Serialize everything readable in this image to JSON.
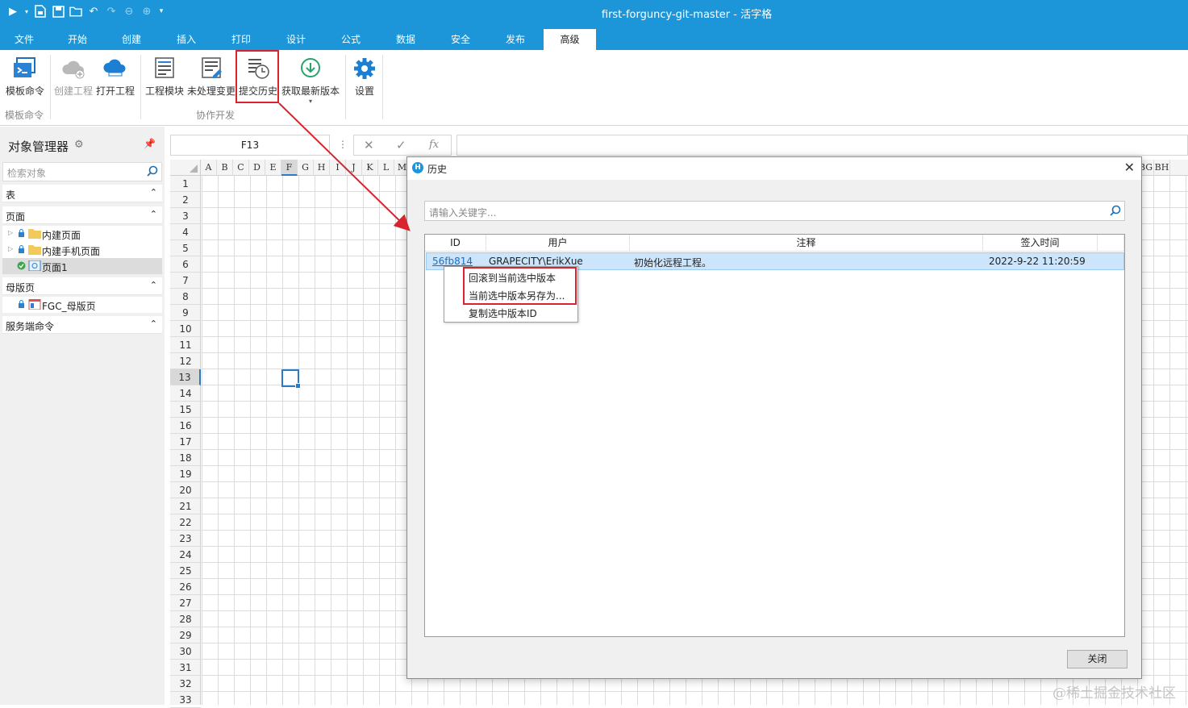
{
  "app": {
    "title": "first-forguncy-git-master - 活字格"
  },
  "tabs": [
    "文件",
    "开始",
    "创建",
    "插入",
    "打印",
    "设计",
    "公式",
    "数据",
    "安全",
    "发布",
    "高级"
  ],
  "ribbon": {
    "buttons": {
      "template_cmd": "模板命令",
      "create_project": "创建工程",
      "open_project": "打开工程",
      "project_module": "工程模块",
      "pending_changes": "未处理变更",
      "commit_history": "提交历史",
      "get_latest": "获取最新版本",
      "settings": "设置"
    },
    "groups": {
      "template": "模板命令",
      "collab": "协作开发"
    }
  },
  "left_panel": {
    "title": "对象管理器",
    "search_placeholder": "检索对象",
    "sections": {
      "tables": "表",
      "pages": "页面",
      "master": "母版页",
      "server": "服务端命令"
    },
    "pages": [
      "内建页面",
      "内建手机页面",
      "页面1"
    ],
    "master_pages": [
      "FGC_母版页"
    ]
  },
  "formula_bar": {
    "cell_ref": "F13",
    "fx": "fx"
  },
  "grid": {
    "columns": [
      "A",
      "B",
      "C",
      "D",
      "E",
      "F",
      "G",
      "H",
      "I",
      "J",
      "K",
      "L",
      "M"
    ],
    "right_cols": [
      "BG",
      "BH"
    ],
    "rows": [
      "1",
      "2",
      "3",
      "4",
      "5",
      "6",
      "7",
      "8",
      "9",
      "10",
      "11",
      "12",
      "13",
      "14",
      "15",
      "16",
      "17",
      "18",
      "19",
      "20",
      "21",
      "22",
      "23",
      "24",
      "25",
      "26",
      "27",
      "28",
      "29",
      "30",
      "31",
      "32",
      "33"
    ]
  },
  "dialog": {
    "title": "历史",
    "search_placeholder": "请输入关键字...",
    "columns": {
      "id": "ID",
      "user": "用户",
      "note": "注释",
      "time": "签入时间"
    },
    "rows": [
      {
        "id": "56fb814",
        "user": "GRAPECITY\\ErikXue",
        "note": "初始化远程工程。",
        "time": "2022-9-22 11:20:59"
      }
    ],
    "context_menu": [
      "回滚到当前选中版本",
      "当前选中版本另存为...",
      "复制选中版本ID"
    ],
    "close_label": "关闭"
  },
  "watermark": "@稀土掘金技术社区",
  "colors": {
    "accent": "#1c96d9",
    "highlight": "#d9232e",
    "selection": "#cce5fb"
  }
}
